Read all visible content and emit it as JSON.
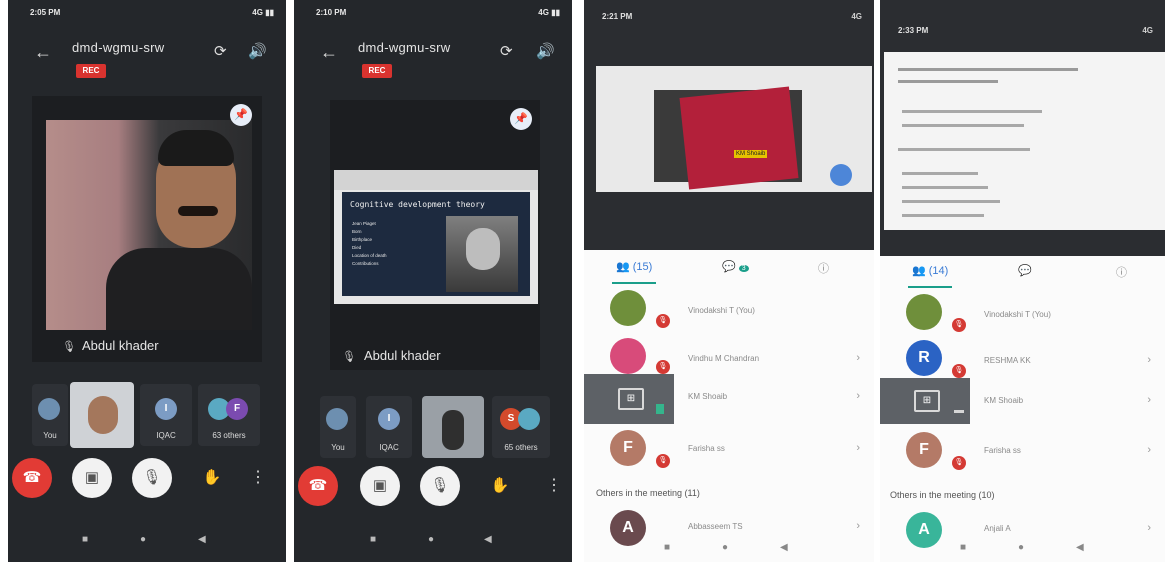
{
  "phones": [
    {
      "status_time": "2:05 PM",
      "status_signal": "4G ▮▮",
      "meeting_title": "dmd-wgmu-srw",
      "rec_label": "REC",
      "speaker_name": "Abdul khader",
      "tiles": [
        {
          "label": "You"
        },
        {
          "label": ""
        },
        {
          "label": "IQAC",
          "initial": "I"
        },
        {
          "label": "63 others",
          "initial": "F"
        }
      ]
    },
    {
      "status_time": "2:10 PM",
      "status_signal": "4G ▮▮",
      "meeting_title": "dmd-wgmu-srw",
      "rec_label": "REC",
      "speaker_name": "Abdul khader",
      "slide_title": "Cognitive development theory",
      "slide_bullets": [
        "Jean Piaget",
        "Born",
        "Birthplace",
        "Died",
        "Location of death",
        "Contributions"
      ],
      "tiles": [
        {
          "label": "You"
        },
        {
          "label": "IQAC",
          "initial": "I"
        },
        {
          "label": ""
        },
        {
          "label": "65 others",
          "initial": "S"
        }
      ]
    },
    {
      "status_time": "2:21 PM",
      "status_signal": "4G",
      "shared_badge": "KM Shoaib",
      "people_count": "(15)",
      "chat_badge": "3",
      "participants": [
        {
          "name": "Vinodakshi T (You)"
        },
        {
          "name": "Vindhu M Chandran"
        },
        {
          "name": "KM Shoaib"
        },
        {
          "name": "Farisha ss",
          "initial": "F"
        }
      ],
      "others_label": "Others in the meeting (11)",
      "others_first": {
        "name": "Abbasseem TS",
        "initial": "A"
      }
    },
    {
      "status_time": "2:33 PM",
      "status_signal": "4G",
      "people_count": "(14)",
      "participants": [
        {
          "name": "Vinodakshi T (You)"
        },
        {
          "name": "RESHMA KK",
          "initial": "R"
        },
        {
          "name": "KM Shoaib"
        },
        {
          "name": "Farisha ss",
          "initial": "F"
        }
      ],
      "others_label": "Others in the meeting (10)",
      "others_first": {
        "name": "Anjali A",
        "initial": "A"
      }
    }
  ],
  "icons": {
    "back": "←",
    "camera_switch": "⟳",
    "speaker": "🔊",
    "pin": "📌",
    "mic_off": "🎙",
    "end_call": "☎",
    "camera_off": "▣",
    "mic_off_btn": "🎙",
    "hand": "✋",
    "more": "⋮",
    "nav_square": "■",
    "nav_circle": "●",
    "nav_back": "◀",
    "people": "👥",
    "chat": "💬",
    "info": "ⓘ",
    "chevron": "›",
    "present": "⊞"
  },
  "colors": {
    "dark_bg": "#24272b",
    "rec_red": "#d9332f",
    "end_red": "#e23b35",
    "accent_teal": "#1a9e8a",
    "blue": "#3a7bd5"
  }
}
